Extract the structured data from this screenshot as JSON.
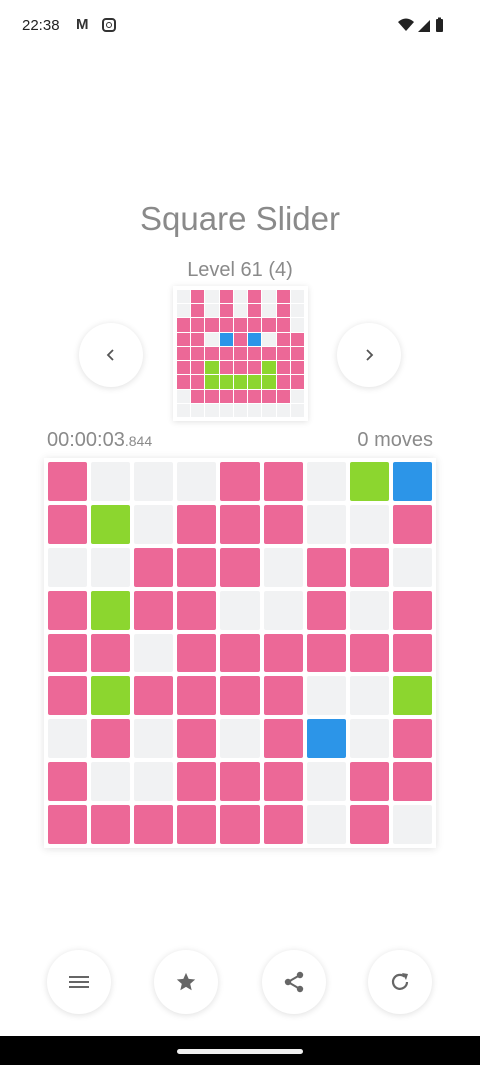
{
  "status_bar": {
    "time": "22:38",
    "gmail_glyph": "M",
    "icons": [
      "gmail-icon",
      "instagram-icon",
      "wifi-icon",
      "signal-icon",
      "battery-icon"
    ]
  },
  "game": {
    "title": "Square Slider",
    "level": "Level 61 (4)",
    "timer_main": "00:00:03",
    "timer_ms": ".844",
    "moves": "0 moves"
  },
  "colors": {
    "empty": "#f1f2f3",
    "pink": "#ec6897",
    "green": "#8cd62f",
    "blue": "#2c95e8",
    "icon_gray": "#666666"
  },
  "preview_grid": [
    "EPEPEPEPE",
    "EPEPEPEPE",
    "PPPPPPPPE",
    "PPEBPBEPP",
    "PPPPPPPPP",
    "PPGPPPGPP",
    "PPGGGGGPP",
    "EPPPPPPPE",
    "EEEEEEEEE"
  ],
  "board_grid": [
    "PEEEPPEGB",
    "PGEPPPEEP",
    "EEPPPEPPE",
    "PGPPEEPEP",
    "PPEPPPPPP",
    "PGPPPPEEG",
    "EPEPEPBEP",
    "PEEPPPEPP",
    "PPPPPPEPE"
  ],
  "controls": {
    "prev_icon": "chevron-left-icon",
    "next_icon": "chevron-right-icon",
    "bottom": [
      "menu-icon",
      "star-icon",
      "share-icon",
      "restart-icon"
    ]
  }
}
